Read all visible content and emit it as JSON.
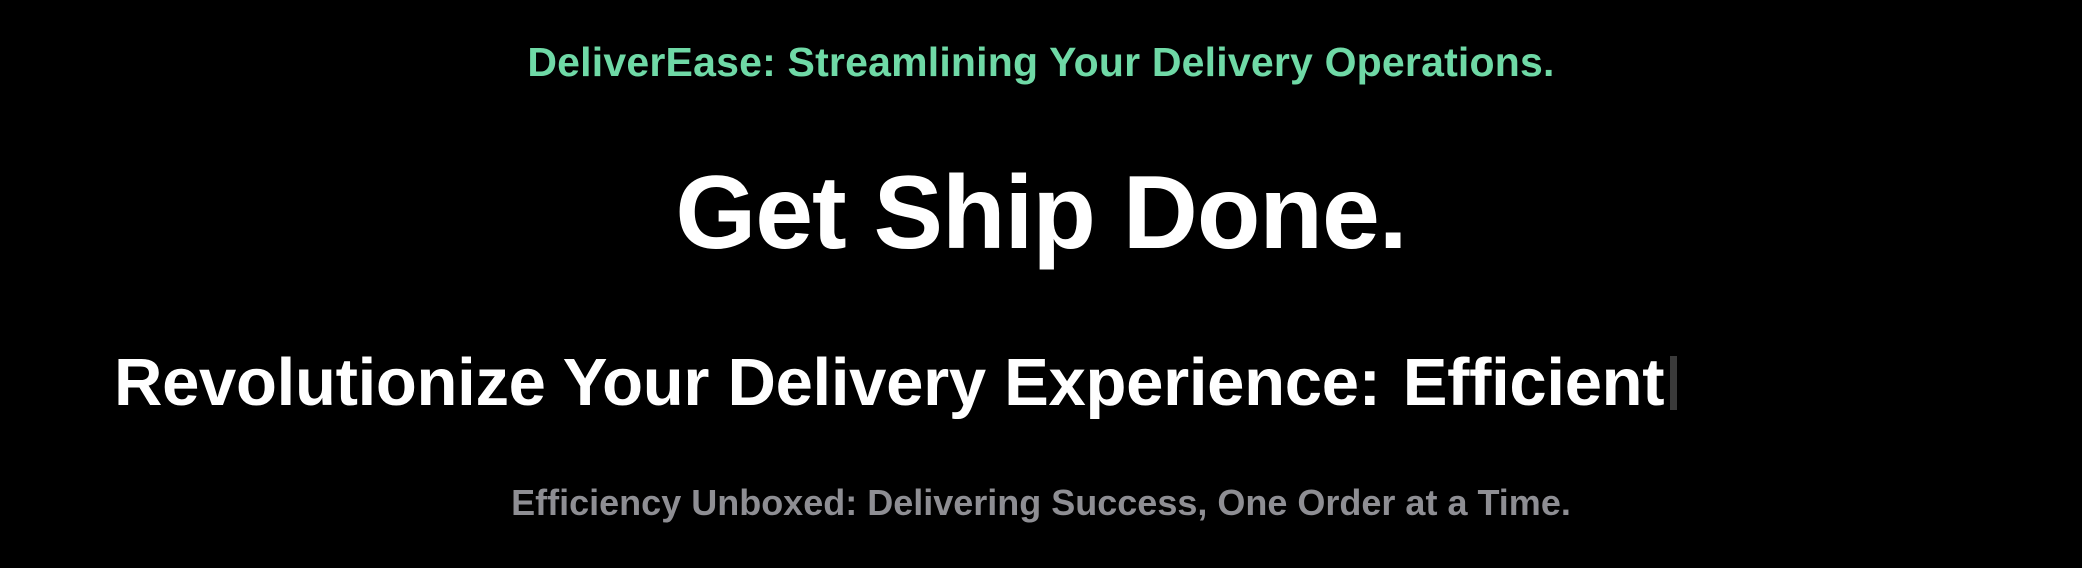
{
  "hero": {
    "tagline": "DeliverEase: Streamlining Your Delivery Operations.",
    "headline": "Get Ship Done.",
    "subheadline": "Revolutionize Your Delivery Experience:",
    "typed_word": "Efficient",
    "footer_line": "Efficiency Unboxed: Delivering Success, One Order at a Time."
  },
  "colors": {
    "background": "#000000",
    "tagline": "#6fd9a6",
    "headline": "#ffffff",
    "footer_line": "#8e8e93"
  }
}
